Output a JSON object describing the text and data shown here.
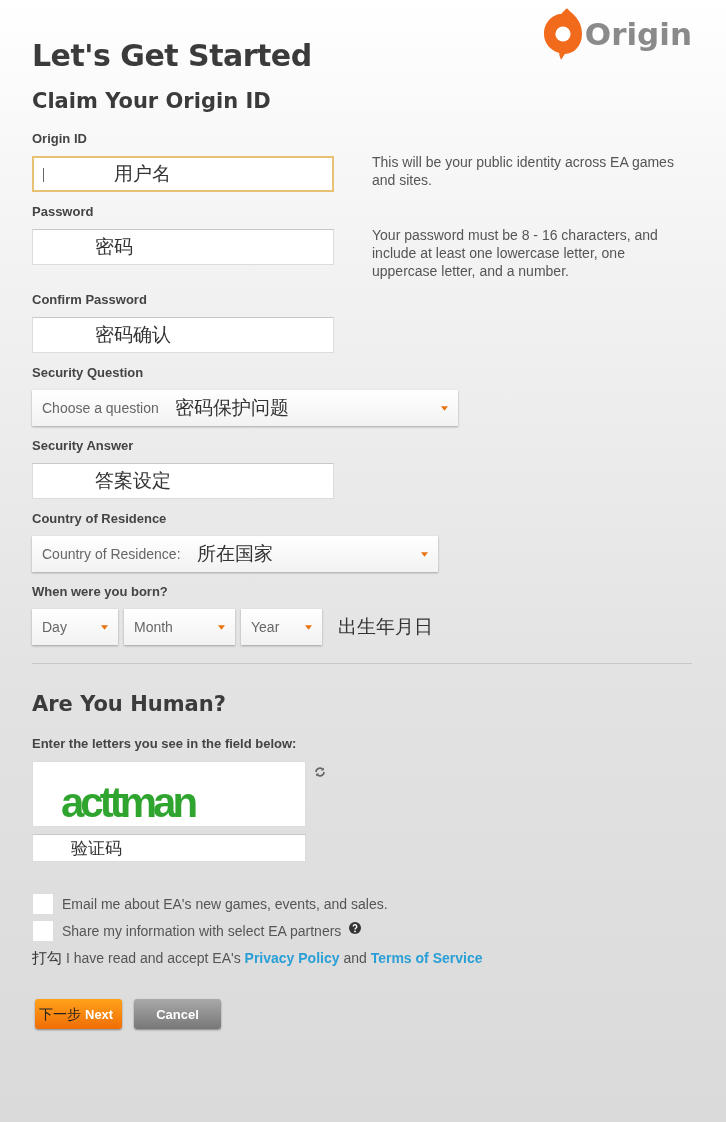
{
  "logo": {
    "name": "Origin"
  },
  "title": "Let's Get Started",
  "subtitle": "Claim Your Origin ID",
  "fields": [
    {
      "kind": "text",
      "label": "Origin ID",
      "value": "用户名",
      "focused": true,
      "hint": "This will be your public identity across EA games and sites."
    },
    {
      "kind": "text",
      "label": "Password",
      "value": "密码",
      "focused": false,
      "hint": "Your password must be 8 - 16 characters, and include at least one lowercase letter, one uppercase letter, and a number."
    },
    {
      "kind": "text",
      "label": "Confirm Password",
      "value": "密码确认",
      "focused": false
    },
    {
      "kind": "select",
      "label": "Security Question",
      "value": "Choose a question",
      "note": "密码保护问题"
    },
    {
      "kind": "text",
      "label": "Security Answer",
      "value": "答案设定",
      "focused": false
    },
    {
      "kind": "select",
      "label": "Country of Residence",
      "value": "Country of Residence:",
      "note": "所在国家"
    },
    {
      "kind": "date",
      "label": "When were you born?",
      "selects": [
        "Day",
        "Month",
        "Year"
      ],
      "note": "出生年月日"
    }
  ],
  "captcha": {
    "heading": "Are You Human?",
    "instruction": "Enter the letters you see in the field below:",
    "image_text": "acttman",
    "value": "验证码"
  },
  "checkboxes": [
    {
      "checked": false,
      "parts": [
        {
          "kind": "text",
          "text": "Email me about EA's new games, events, and sales."
        }
      ]
    },
    {
      "checked": false,
      "help": true,
      "parts": [
        {
          "kind": "text",
          "text": "Share my information with select EA partners"
        }
      ]
    },
    {
      "note": "打勾",
      "parts": [
        {
          "kind": "text",
          "text": "I have read and accept EA's "
        },
        {
          "kind": "link",
          "text": "Privacy Policy"
        },
        {
          "kind": "text",
          "text": " and "
        },
        {
          "kind": "link",
          "text": "Terms of Service"
        }
      ]
    }
  ],
  "buttons": [
    {
      "kind": "primary",
      "label": "Next",
      "note": "下一步"
    },
    {
      "kind": "secondary",
      "label": "Cancel"
    }
  ]
}
